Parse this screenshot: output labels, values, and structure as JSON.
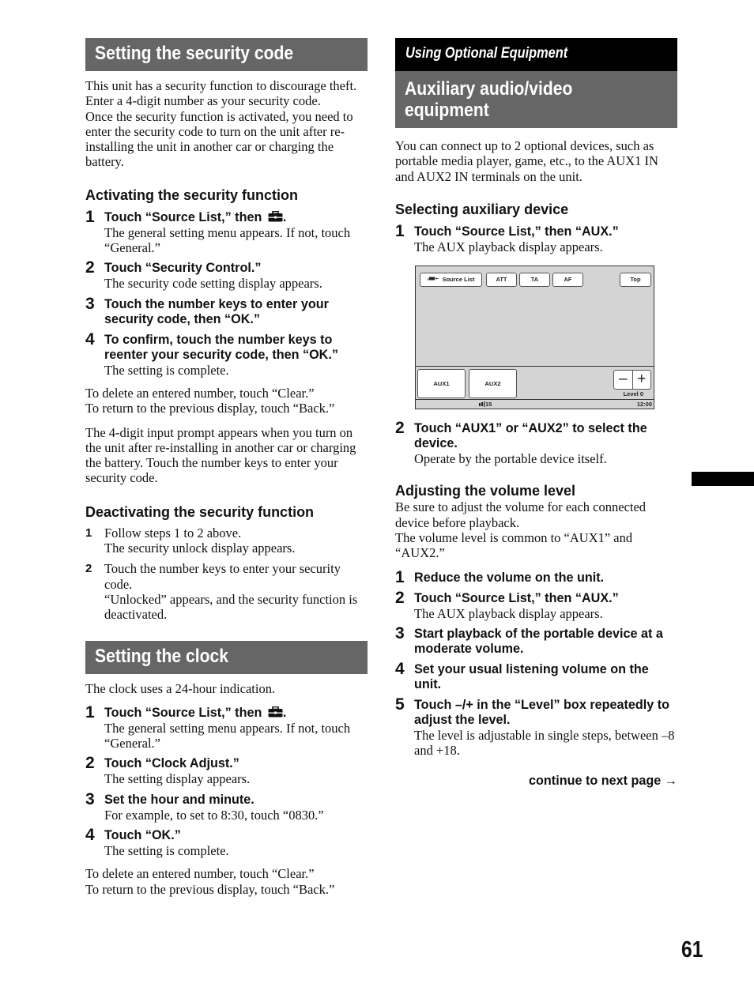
{
  "left": {
    "security": {
      "banner": "Setting the security code",
      "intro": [
        "This unit has a security function to discourage theft. Enter a 4-digit number as your security code.",
        "Once the security function is activated, you need to enter the security code to turn on the unit after re-installing the unit in another car or charging the battery."
      ],
      "activating": {
        "heading": "Activating the security function",
        "steps": [
          {
            "num": "1",
            "title": "Touch “Source List,” then",
            "icon": "toolbox-icon",
            "title_end": ".",
            "desc": "The general setting menu appears. If not, touch “General.”"
          },
          {
            "num": "2",
            "title": "Touch “Security Control.”",
            "desc": "The security code setting display appears."
          },
          {
            "num": "3",
            "title": "Touch the number keys to enter your security code, then “OK.”",
            "desc": ""
          },
          {
            "num": "4",
            "title": "To confirm, touch the number keys to reenter your security code, then “OK.”",
            "desc": "The setting is complete."
          }
        ],
        "note1": [
          "To delete an entered number, touch “Clear.”",
          "To return to the previous display, touch “Back.”"
        ],
        "note2": "The 4-digit input prompt appears when you turn on the unit after re-installing in another car or charging the battery. Touch the number keys to enter your security code."
      },
      "deactivating": {
        "heading": "Deactivating the security function",
        "steps": [
          {
            "num": "1",
            "title": "Follow steps 1 to 2 above.",
            "desc": "The security unlock display appears."
          },
          {
            "num": "2",
            "title": "Touch the number keys to enter your security code.",
            "desc": "“Unlocked” appears, and the security function is deactivated."
          }
        ]
      }
    },
    "clock": {
      "banner": "Setting the clock",
      "intro": "The clock uses a 24-hour indication.",
      "steps": [
        {
          "num": "1",
          "title": "Touch “Source List,” then",
          "icon": "toolbox-icon",
          "title_end": ".",
          "desc": "The general setting menu appears. If not, touch “General.”"
        },
        {
          "num": "2",
          "title": "Touch “Clock Adjust.”",
          "desc": "The setting display appears."
        },
        {
          "num": "3",
          "title": "Set the hour and minute.",
          "desc": "For example, to set to 8:30, touch “0830.”"
        },
        {
          "num": "4",
          "title": "Touch “OK.”",
          "desc": "The setting is complete."
        }
      ],
      "note": [
        "To delete an entered number, touch “Clear.”",
        "To return to the previous display, touch “Back.”"
      ]
    }
  },
  "right": {
    "chapter": "Using Optional Equipment",
    "banner": [
      "Auxiliary audio/video",
      "equipment"
    ],
    "intro": "You can connect up to 2 optional devices, such as portable media player, game, etc., to the AUX1 IN and AUX2 IN terminals on the unit.",
    "selecting": {
      "heading": "Selecting auxiliary device",
      "step1": {
        "num": "1",
        "title": "Touch “Source List,” then “AUX.”",
        "desc": "The AUX playback display appears."
      },
      "step2": {
        "num": "2",
        "title": "Touch “AUX1” or “AUX2” to select the device.",
        "desc": "Operate by the portable device itself."
      }
    },
    "screen": {
      "source_list": "Source List",
      "att": "ATT",
      "ta": "TA",
      "af": "AF",
      "top": "Top",
      "aux1": "AUX1",
      "aux2": "AUX2",
      "minus": "–",
      "plus": "+",
      "level": "Level 0",
      "volume": "15",
      "clock": "12:00"
    },
    "volume": {
      "heading": "Adjusting the volume level",
      "intro": [
        "Be sure to adjust the volume for each connected device before playback.",
        "The volume level is common to “AUX1” and “AUX2.”"
      ],
      "steps": [
        {
          "num": "1",
          "title": "Reduce the volume on the unit.",
          "desc": ""
        },
        {
          "num": "2",
          "title": "Touch “Source List,” then “AUX.”",
          "desc": "The AUX playback display appears."
        },
        {
          "num": "3",
          "title": "Start playback of the portable device at a moderate volume.",
          "desc": ""
        },
        {
          "num": "4",
          "title": "Set your usual listening volume on the unit.",
          "desc": ""
        },
        {
          "num": "5",
          "title": "Touch –/+ in the “Level” box repeatedly to adjust the level.",
          "desc": "The level is adjustable in single steps, between –8 and +18."
        }
      ]
    },
    "continue": "continue to next page →"
  },
  "page_number": "61"
}
